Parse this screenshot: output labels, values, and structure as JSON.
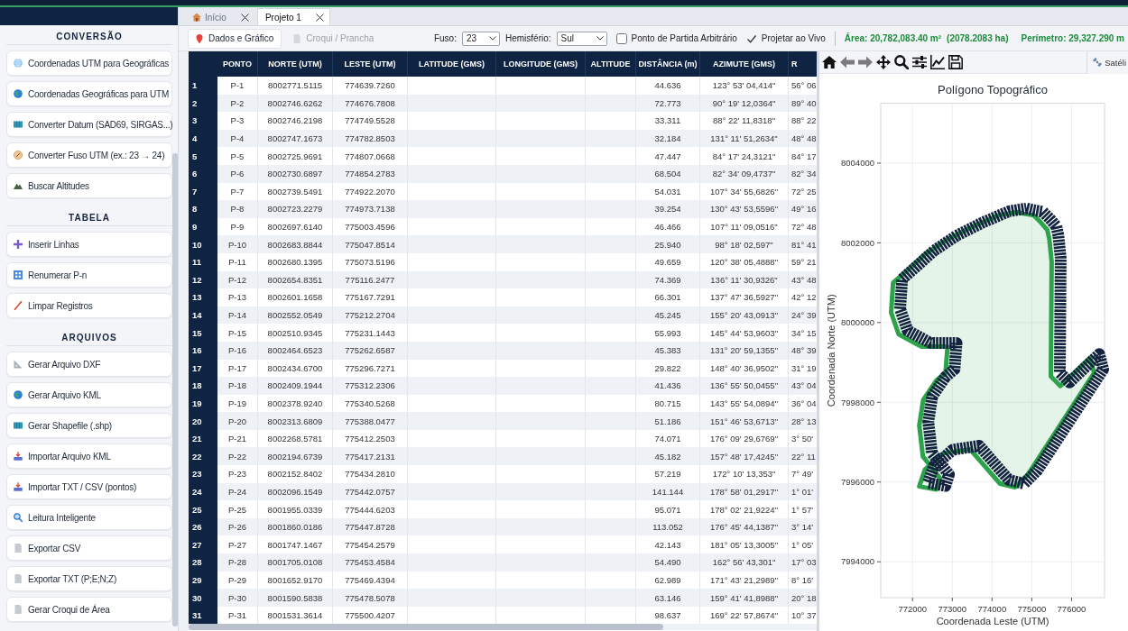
{
  "sidebar": {
    "sections": [
      {
        "title": "CONVERSÃO",
        "items": [
          "Coordenadas UTM para Geográficas",
          "Coordenadas Geográficas para UTM",
          "Converter Datum (SAD69, SIRGAS...)",
          "Converter Fuso UTM (ex.: 23 → 24)",
          "Buscar Altitudes"
        ]
      },
      {
        "title": "TABELA",
        "items": [
          "Inserir Linhas",
          "Renumerar P-n",
          "Limpar Registros"
        ]
      },
      {
        "title": "ARQUIVOS",
        "items": [
          "Gerar Arquivo DXF",
          "Gerar Arquivo KML",
          "Gerar Shapefile (.shp)",
          "Importar Arquivo KML",
          "Importar TXT / CSV (pontos)",
          "Leitura Inteligente",
          "Exportar CSV",
          "Exportar TXT (P;E;N;Z)",
          "Gerar Croqui de Área"
        ]
      }
    ]
  },
  "tabs": [
    {
      "kind": "home",
      "label": "Início",
      "selected": false
    },
    {
      "kind": "project",
      "label": "Projeto 1",
      "selected": true
    }
  ],
  "toolbar": {
    "views": [
      {
        "label": "Dados e Gráfico",
        "selected": true
      },
      {
        "label": "Croqui / Prancha",
        "selected": false
      }
    ],
    "fuso": {
      "label": "Fuso:",
      "value": "23"
    },
    "hemisferio": {
      "label": "Hemisfério:",
      "value": "Sul"
    },
    "arbitrary_start": {
      "label": "Ponto de Partida Arbitrário",
      "checked": false
    },
    "live_projection": {
      "label": "Projetar ao Vivo",
      "checked": true
    },
    "area": "Área: 20,782,083.40 m²",
    "area_ha": "(2078.2083 ha)",
    "perimeter": "Perímetro: 29,327.290 m"
  },
  "table": {
    "columns": [
      "PONTO",
      "NORTE (UTM)",
      "LESTE (UTM)",
      "LATITUDE (GMS)",
      "LONGITUDE (GMS)",
      "ALTITUDE",
      "DISTÂNCIA (m)",
      "AZIMUTE (GMS)",
      "R"
    ],
    "rows": [
      {
        "n": "1",
        "ponto": "P-1",
        "norte": "8002771.5115",
        "leste": "774639.7260",
        "distancia": "44.636",
        "azimute": "123° 53' 04,414\"",
        "column_10": "56° 06"
      },
      {
        "n": "2",
        "ponto": "P-2",
        "norte": "8002746.6262",
        "leste": "774676.7808",
        "distancia": "72.773",
        "azimute": "90° 19' 12,0364\"",
        "column_10": "89° 40"
      },
      {
        "n": "3",
        "ponto": "P-3",
        "norte": "8002746.2198",
        "leste": "774749.5528",
        "distancia": "33.311",
        "azimute": "88° 22' 11,8318\"",
        "column_10": "88° 22"
      },
      {
        "n": "4",
        "ponto": "P-4",
        "norte": "8002747.1673",
        "leste": "774782.8503",
        "distancia": "32.184",
        "azimute": "131° 11' 51,2634\"",
        "column_10": "48° 48"
      },
      {
        "n": "5",
        "ponto": "P-5",
        "norte": "8002725.9691",
        "leste": "774807.0668",
        "distancia": "47.447",
        "azimute": "84° 17' 24,3121\"",
        "column_10": "84° 17"
      },
      {
        "n": "6",
        "ponto": "P-6",
        "norte": "8002730.6897",
        "leste": "774854.2783",
        "distancia": "68.504",
        "azimute": "82° 34' 09,4737\"",
        "column_10": "82° 34"
      },
      {
        "n": "7",
        "ponto": "P-7",
        "norte": "8002739.5491",
        "leste": "774922.2070",
        "distancia": "54.031",
        "azimute": "107° 34' 55,6826\"",
        "column_10": "72° 25"
      },
      {
        "n": "8",
        "ponto": "P-8",
        "norte": "8002723.2279",
        "leste": "774973.7138",
        "distancia": "39.254",
        "azimute": "130° 43' 53,5596\"",
        "column_10": "49° 16"
      },
      {
        "n": "9",
        "ponto": "P-9",
        "norte": "8002697.6140",
        "leste": "775003.4596",
        "distancia": "46.466",
        "azimute": "107° 11' 09,0516\"",
        "column_10": "72° 48"
      },
      {
        "n": "10",
        "ponto": "P-10",
        "norte": "8002683.8844",
        "leste": "775047.8514",
        "distancia": "25.940",
        "azimute": "98° 18' 02,597\"",
        "column_10": "81° 41"
      },
      {
        "n": "11",
        "ponto": "P-11",
        "norte": "8002680.1395",
        "leste": "775073.5196",
        "distancia": "49.659",
        "azimute": "120° 38' 05,4888\"",
        "column_10": "59° 21"
      },
      {
        "n": "12",
        "ponto": "P-12",
        "norte": "8002654.8351",
        "leste": "775116.2477",
        "distancia": "74.369",
        "azimute": "136° 11' 30,9326\"",
        "column_10": "43° 48"
      },
      {
        "n": "13",
        "ponto": "P-13",
        "norte": "8002601.1658",
        "leste": "775167.7291",
        "distancia": "66.301",
        "azimute": "137° 47' 36,5927\"",
        "column_10": "42° 12"
      },
      {
        "n": "14",
        "ponto": "P-14",
        "norte": "8002552.0549",
        "leste": "775212.2704",
        "distancia": "45.245",
        "azimute": "155° 20' 43,0913\"",
        "column_10": "24° 39"
      },
      {
        "n": "15",
        "ponto": "P-15",
        "norte": "8002510.9345",
        "leste": "775231.1443",
        "distancia": "55.993",
        "azimute": "145° 44' 53,9603\"",
        "column_10": "34° 15"
      },
      {
        "n": "16",
        "ponto": "P-16",
        "norte": "8002464.6523",
        "leste": "775262.6587",
        "distancia": "45.383",
        "azimute": "131° 20' 59,1355\"",
        "column_10": "48° 39"
      },
      {
        "n": "17",
        "ponto": "P-17",
        "norte": "8002434.6700",
        "leste": "775296.7271",
        "distancia": "29.822",
        "azimute": "148° 40' 36,9502\"",
        "column_10": "31° 19"
      },
      {
        "n": "18",
        "ponto": "P-18",
        "norte": "8002409.1944",
        "leste": "775312.2306",
        "distancia": "41.436",
        "azimute": "136° 55' 50,0455\"",
        "column_10": "43° 04"
      },
      {
        "n": "19",
        "ponto": "P-19",
        "norte": "8002378.9240",
        "leste": "775340.5268",
        "distancia": "80.715",
        "azimute": "143° 55' 54,0894\"",
        "column_10": "36° 04"
      },
      {
        "n": "20",
        "ponto": "P-20",
        "norte": "8002313.6809",
        "leste": "775388.0477",
        "distancia": "51.186",
        "azimute": "151° 46' 53,6713\"",
        "column_10": "28° 13"
      },
      {
        "n": "21",
        "ponto": "P-21",
        "norte": "8002268.5781",
        "leste": "775412.2503",
        "distancia": "74.071",
        "azimute": "176° 09' 29,6769\"",
        "column_10": "3° 50'"
      },
      {
        "n": "22",
        "ponto": "P-22",
        "norte": "8002194.6739",
        "leste": "775417.2131",
        "distancia": "45.182",
        "azimute": "157° 48' 17,4245\"",
        "column_10": "22° 11"
      },
      {
        "n": "23",
        "ponto": "P-23",
        "norte": "8002152.8402",
        "leste": "775434.2810",
        "distancia": "57.219",
        "azimute": "172° 10' 13,353\"",
        "column_10": "7° 49'"
      },
      {
        "n": "24",
        "ponto": "P-24",
        "norte": "8002096.1549",
        "leste": "775442.0757",
        "distancia": "141.144",
        "azimute": "178° 58' 01,2917\"",
        "column_10": "1° 01'"
      },
      {
        "n": "25",
        "ponto": "P-25",
        "norte": "8001955.0339",
        "leste": "775444.6203",
        "distancia": "95.071",
        "azimute": "178° 02' 21,9224\"",
        "column_10": "1° 57'"
      },
      {
        "n": "26",
        "ponto": "P-26",
        "norte": "8001860.0186",
        "leste": "775447.8728",
        "distancia": "113.052",
        "azimute": "176° 45' 44,1387\"",
        "column_10": "3° 14'"
      },
      {
        "n": "27",
        "ponto": "P-27",
        "norte": "8001747.1467",
        "leste": "775454.2579",
        "distancia": "42.143",
        "azimute": "181° 05' 13,3005\"",
        "column_10": "1° 05'"
      },
      {
        "n": "28",
        "ponto": "P-28",
        "norte": "8001705.0108",
        "leste": "775453.4584",
        "distancia": "54.490",
        "azimute": "162° 56' 43,301\"",
        "column_10": "17° 03"
      },
      {
        "n": "29",
        "ponto": "P-29",
        "norte": "8001652.9170",
        "leste": "775469.4394",
        "distancia": "62.989",
        "azimute": "171° 43' 21,2989\"",
        "column_10": "8° 16'"
      },
      {
        "n": "30",
        "ponto": "P-30",
        "norte": "8001590.5838",
        "leste": "775478.5078",
        "distancia": "63.146",
        "azimute": "159° 41' 41,8988\"",
        "column_10": "20° 18"
      },
      {
        "n": "31",
        "ponto": "P-31",
        "norte": "8001531.3614",
        "leste": "775500.4207",
        "distancia": "98.637",
        "azimute": "169° 22' 57,8674\"",
        "column_10": "10° 37"
      }
    ]
  },
  "plot_panel": {
    "tools": [
      {
        "kind": "home",
        "disabled": false
      },
      {
        "kind": "back",
        "disabled": true
      },
      {
        "kind": "forward",
        "disabled": true
      },
      {
        "kind": "pan",
        "disabled": false
      },
      {
        "kind": "zoom",
        "disabled": false
      },
      {
        "kind": "configure",
        "disabled": false
      },
      {
        "kind": "edit",
        "disabled": false
      },
      {
        "kind": "save",
        "disabled": false
      }
    ],
    "satellite_button": "Satéli",
    "chart_data": {
      "type": "area",
      "title": "Polígono Topográfico",
      "xlabel": "Coordenada Leste (UTM)",
      "ylabel": "Coordenada Norte (UTM)",
      "x": [
        774640,
        774810,
        775050,
        775230,
        775390,
        775440,
        775500,
        775480,
        775720,
        776470,
        776570,
        774910,
        774580,
        774200,
        773830,
        773450,
        772790,
        772310,
        772170,
        772600,
        772690,
        772260,
        772170,
        772270,
        772600,
        772830,
        772880,
        772220,
        771650,
        771460,
        771510,
        771840,
        772310,
        772880,
        773540,
        774200,
        774640
      ],
      "series": [
        {
          "color": "#2ca24a",
          "values": [
            8002770,
            8002730,
            8002690,
            8002510,
            8002320,
            8002100,
            8001530,
            7998650,
            7998410,
            7999120,
            7998740,
            7996200,
            7995870,
            7995960,
            7996380,
            7996820,
            7996720,
            7996310,
            7995890,
            7995810,
            7996100,
            7996640,
            7997420,
            7998060,
            7998550,
            7998740,
            7999400,
            7999400,
            7999710,
            8000250,
            8001000,
            8001290,
            8001710,
            8002090,
            8002420,
            8002700,
            8002770
          ]
        }
      ],
      "xlim": [
        771200,
        776830
      ],
      "ylim": [
        7993100,
        8005500
      ],
      "xticks": [
        772000,
        773000,
        774000,
        775000,
        776000
      ],
      "yticks": [
        7994000,
        7996000,
        7998000,
        8000000,
        8002000,
        8004000
      ],
      "grid": true
    }
  }
}
